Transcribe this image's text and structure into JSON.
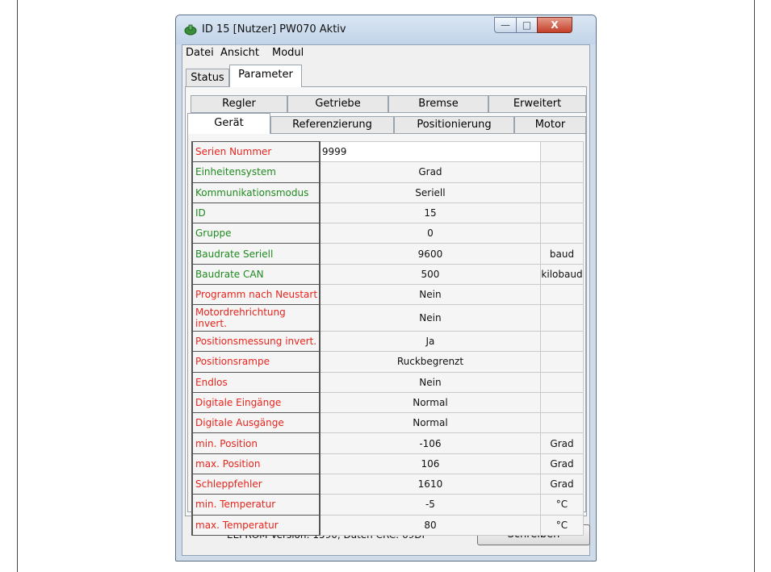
{
  "window": {
    "title": "ID 15 [Nutzer] PW070 Aktiv",
    "min_glyph": "—",
    "max_glyph": "□",
    "close_glyph": "X"
  },
  "menu": [
    "Datei",
    "Ansicht",
    "Modul"
  ],
  "top_tabs": [
    "Status",
    "Parameter"
  ],
  "top_tab_active": "Parameter",
  "tab_row_back": [
    "Regler",
    "Getriebe",
    "Bremse",
    "Erweitert"
  ],
  "tab_row_front": [
    "Gerät",
    "Referenzierung",
    "Positionierung",
    "Motor"
  ],
  "tab_active": "Gerät",
  "colors": {
    "required": "#e8241c",
    "optional": "#1f8a1f"
  },
  "parameters": [
    {
      "label": "Serien Nummer",
      "value": "9999",
      "unit": "",
      "color": "red",
      "editing": true
    },
    {
      "label": "Einheitensystem",
      "value": "Grad",
      "unit": "",
      "color": "green"
    },
    {
      "label": "Kommunikationsmodus",
      "value": "Seriell",
      "unit": "",
      "color": "green"
    },
    {
      "label": "ID",
      "value": "15",
      "unit": "",
      "color": "green"
    },
    {
      "label": "Gruppe",
      "value": "0",
      "unit": "",
      "color": "green"
    },
    {
      "label": "Baudrate Seriell",
      "value": "9600",
      "unit": "baud",
      "color": "green"
    },
    {
      "label": "Baudrate CAN",
      "value": "500",
      "unit": "kilobaud",
      "color": "green"
    },
    {
      "label": "Programm nach Neustart",
      "value": "Nein",
      "unit": "",
      "color": "red"
    },
    {
      "label": "Motordrehrichtung invert.",
      "value": "Nein",
      "unit": "",
      "color": "red"
    },
    {
      "label": "Positionsmessung invert.",
      "value": "Ja",
      "unit": "",
      "color": "red"
    },
    {
      "label": "Positionsrampe",
      "value": "Ruckbegrenzt",
      "unit": "",
      "color": "red"
    },
    {
      "label": "Endlos",
      "value": "Nein",
      "unit": "",
      "color": "red"
    },
    {
      "label": "Digitale Eingänge",
      "value": "Normal",
      "unit": "",
      "color": "red"
    },
    {
      "label": "Digitale Ausgänge",
      "value": "Normal",
      "unit": "",
      "color": "red"
    },
    {
      "label": "min. Position",
      "value": "-106",
      "unit": "Grad",
      "color": "red"
    },
    {
      "label": "max. Position",
      "value": "106",
      "unit": "Grad",
      "color": "red"
    },
    {
      "label": "Schleppfehler",
      "value": "1610",
      "unit": "Grad",
      "color": "red"
    },
    {
      "label": "min. Temperatur",
      "value": "-5",
      "unit": "°C",
      "color": "red"
    },
    {
      "label": "max. Temperatur",
      "value": "80",
      "unit": "°C",
      "color": "red"
    }
  ],
  "status": {
    "text": "EEPROM Version: 1590, Daten CRC: 69DF",
    "write_button": "Schreiben"
  }
}
